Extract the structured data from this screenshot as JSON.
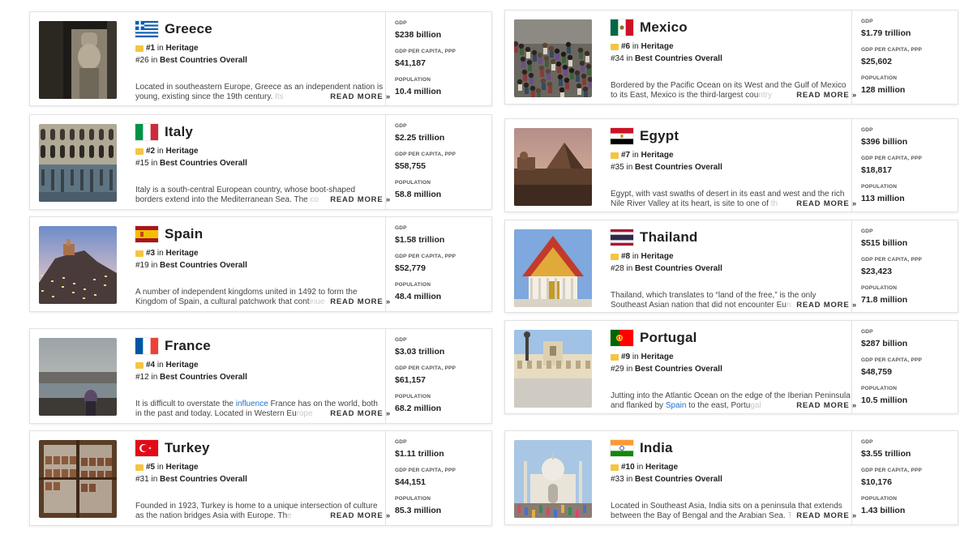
{
  "stat_labels": {
    "gdp": "GDP",
    "gdp_per_capita": "GDP PER CAPITA, PPP",
    "population": "POPULATION"
  },
  "rank_connector": "in",
  "heritage_label": "Heritage",
  "overall_label": "Best Countries Overall",
  "read_more": "READ MORE »",
  "countries": [
    {
      "name": "Greece",
      "rank": "#1",
      "overall": "#26",
      "desc_a": "Located in southeastern Europe, Greece as an independent nation is young, existing since the 19th century. ",
      "desc_link": "",
      "desc_b": "",
      "desc_fade": "Its",
      "gdp": "$238 billion",
      "gdp_pc": "$41,187",
      "population": "10.4 million",
      "flag_icon": "greece-flag-icon",
      "image_icon": "greece-statue-photo"
    },
    {
      "name": "Italy",
      "rank": "#2",
      "overall": "#15",
      "desc_a": "Italy is a south-central European country, whose boot-shaped borders extend into the Mediterranean Sea. The ",
      "desc_link": "",
      "desc_b": "",
      "desc_fade": "co",
      "gdp": "$2.25 trillion",
      "gdp_pc": "$58,755",
      "population": "58.8 million",
      "flag_icon": "italy-flag-icon",
      "image_icon": "venice-photo"
    },
    {
      "name": "Spain",
      "rank": "#3",
      "overall": "#19",
      "desc_a": "A number of independent kingdoms united in 1492 to form the Kingdom of Spain, a cultural patchwork that cont",
      "desc_link": "",
      "desc_b": "",
      "desc_fade": "inues",
      "gdp": "$1.58 trillion",
      "gdp_pc": "$52,779",
      "population": "48.4 million",
      "flag_icon": "spain-flag-icon",
      "image_icon": "spain-hilltown-photo"
    },
    {
      "name": "France",
      "rank": "#4",
      "overall": "#12",
      "desc_a": "It is difficult to overstate the ",
      "desc_link": "influence",
      "desc_b": " France has on the world, both in the past and today. Located in Western Eu",
      "desc_fade": "rope",
      "gdp": "$3.03 trillion",
      "gdp_pc": "$61,157",
      "population": "68.2 million",
      "flag_icon": "france-flag-icon",
      "image_icon": "paris-river-photo"
    },
    {
      "name": "Turkey",
      "rank": "#5",
      "overall": "#31",
      "desc_a": "Founded in 1923, Turkey is home to a unique intersection of culture as the nation bridges Asia with Europe. Th",
      "desc_link": "",
      "desc_b": "",
      "desc_fade": "e",
      "gdp": "$1.11 trillion",
      "gdp_pc": "$44,151",
      "population": "85.3 million",
      "flag_icon": "turkey-flag-icon",
      "image_icon": "istanbul-window-photo"
    },
    {
      "name": "Mexico",
      "rank": "#6",
      "overall": "#34",
      "desc_a": "Bordered by the Pacific Ocean on its West and the Gulf of Mexico to its East, Mexico is the third-largest cou",
      "desc_link": "",
      "desc_b": "",
      "desc_fade": "ntry",
      "gdp": "$1.79 trillion",
      "gdp_pc": "$25,602",
      "population": "128 million",
      "flag_icon": "mexico-flag-icon",
      "image_icon": "mexico-crowd-photo"
    },
    {
      "name": "Egypt",
      "rank": "#7",
      "overall": "#35",
      "desc_a": "Egypt, with vast swaths of desert in its east and west and the rich Nile River Valley at its heart, is site to one of ",
      "desc_link": "",
      "desc_b": "",
      "desc_fade": "th",
      "gdp": "$396 billion",
      "gdp_pc": "$18,817",
      "population": "113 million",
      "flag_icon": "egypt-flag-icon",
      "image_icon": "pyramids-photo"
    },
    {
      "name": "Thailand",
      "rank": "#8",
      "overall": "#28",
      "desc_a": "Thailand, which translates to “land of the free,” is the only Southeast Asian nation that did not encounter Eu",
      "desc_link": "",
      "desc_b": "",
      "desc_fade": "ro",
      "gdp": "$515 billion",
      "gdp_pc": "$23,423",
      "population": "71.8 million",
      "flag_icon": "thailand-flag-icon",
      "image_icon": "thai-temple-photo"
    },
    {
      "name": "Portugal",
      "rank": "#9",
      "overall": "#29",
      "desc_a": "Jutting into the Atlantic Ocean on the edge of the Iberian Peninsula and flanked by ",
      "desc_link": "Spain",
      "desc_b": " to the east, Portu",
      "desc_fade": "gal",
      "gdp": "$287 billion",
      "gdp_pc": "$48,759",
      "population": "10.5 million",
      "flag_icon": "portugal-flag-icon",
      "image_icon": "lisbon-square-photo"
    },
    {
      "name": "India",
      "rank": "#10",
      "overall": "#33",
      "desc_a": "Located in Southeast Asia, India sits on a peninsula that extends between the Bay of Bengal and the Arabian Sea. ",
      "desc_link": "",
      "desc_b": "",
      "desc_fade": "T",
      "gdp": "$3.55 trillion",
      "gdp_pc": "$10,176",
      "population": "1.43 billion",
      "flag_icon": "india-flag-icon",
      "image_icon": "taj-mahal-photo"
    }
  ]
}
